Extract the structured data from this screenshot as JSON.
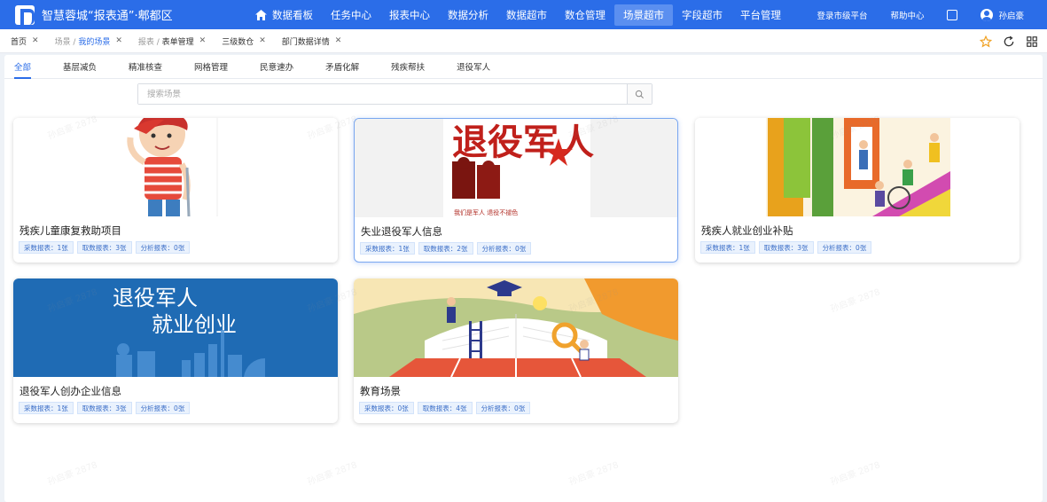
{
  "app": {
    "title": "智慧蓉城“报表通”·郫都区"
  },
  "nav": {
    "items": [
      {
        "label": "数据看板"
      },
      {
        "label": "任务中心"
      },
      {
        "label": "报表中心"
      },
      {
        "label": "数据分析"
      },
      {
        "label": "数据超市"
      },
      {
        "label": "数仓管理"
      },
      {
        "label": "场景超市"
      },
      {
        "label": "字段超市"
      },
      {
        "label": "平台管理"
      }
    ],
    "active": "场景超市"
  },
  "header_right": {
    "login_city": "登录市级平台",
    "help": "帮助中心",
    "user_name": "孙启豪"
  },
  "tabs": [
    {
      "label": "首页"
    },
    {
      "prefix": "场景 / ",
      "label": "我的场景"
    },
    {
      "prefix": "报表 / ",
      "label": "表单管理"
    },
    {
      "label": "三级数仓"
    },
    {
      "label": "部门数据详情"
    }
  ],
  "categories": [
    "全部",
    "基层减负",
    "精准核查",
    "网格管理",
    "民意速办",
    "矛盾化解",
    "残疾帮扶",
    "退役军人"
  ],
  "search": {
    "placeholder": "搜索场景"
  },
  "cards": [
    {
      "title": "残疾儿童康复救助项目",
      "badges": [
        "采数报表：1张",
        "取数报表：3张",
        "分析报表：0张"
      ]
    },
    {
      "title": "失业退役军人信息",
      "image_text": "退役军人",
      "image_subtext": "我们是军人 退役不褪色",
      "badges": [
        "采数报表：1张",
        "取数报表：2张",
        "分析报表：0张"
      ]
    },
    {
      "title": "残疾人就业创业补贴",
      "badges": [
        "采数报表：1张",
        "取数报表：3张",
        "分析报表：0张"
      ]
    },
    {
      "title": "退役军人创办企业信息",
      "image_text_1": "退役军人",
      "image_text_2": "就业创业",
      "badges": [
        "采数报表：1张",
        "取数报表：3张",
        "分析报表：0张"
      ]
    },
    {
      "title": "教育场景",
      "badges": [
        "采数报表：0张",
        "取数报表：4张",
        "分析报表：0张"
      ]
    }
  ],
  "watermark": "孙启豪 2878",
  "colors": {
    "primary": "#2b6de8",
    "badge_bg": "#eaf2fd",
    "badge_text": "#3c6fc8"
  }
}
